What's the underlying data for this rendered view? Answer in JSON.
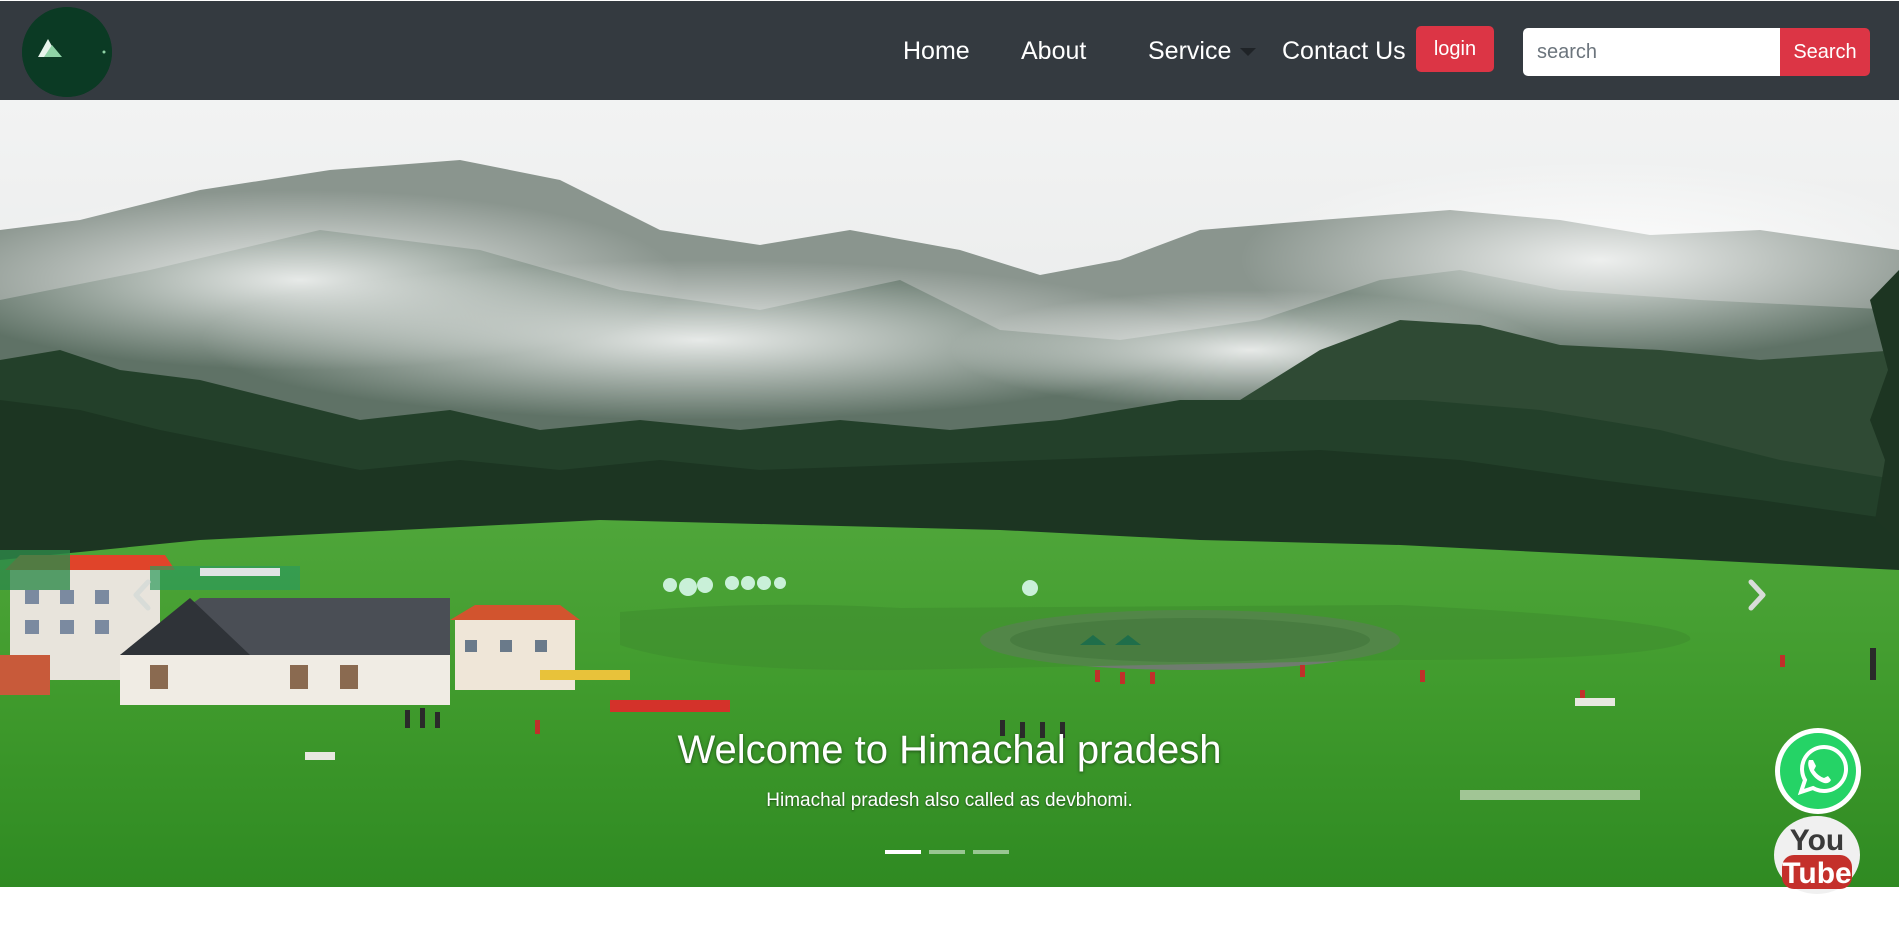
{
  "navbar": {
    "logo": {
      "icon": "mountain-logo-icon"
    },
    "links": [
      {
        "label": "Home"
      },
      {
        "label": "About"
      },
      {
        "label": "Service",
        "icon": "caret-down-icon"
      },
      {
        "label": "Contact Us"
      }
    ],
    "login_label": "login",
    "search": {
      "placeholder": "search",
      "value": "",
      "button_label": "Search"
    }
  },
  "carousel": {
    "caption_title": "Welcome to Himachal pradesh",
    "caption_text": "Himachal pradesh also called as devbhomi.",
    "indicators": [
      {
        "active": true
      },
      {
        "active": false
      },
      {
        "active": false
      }
    ],
    "prev_icon": "chevron-left-icon",
    "next_icon": "chevron-right-icon"
  },
  "social": {
    "whatsapp": {
      "icon": "whatsapp-icon"
    },
    "youtube": {
      "icon": "youtube-icon",
      "text_top": "You",
      "text_bottom": "Tube"
    }
  },
  "colors": {
    "navbar_bg": "#343a40",
    "accent_red": "#dc3545",
    "whatsapp_green": "#25d366",
    "youtube_red": "#c4302b"
  }
}
